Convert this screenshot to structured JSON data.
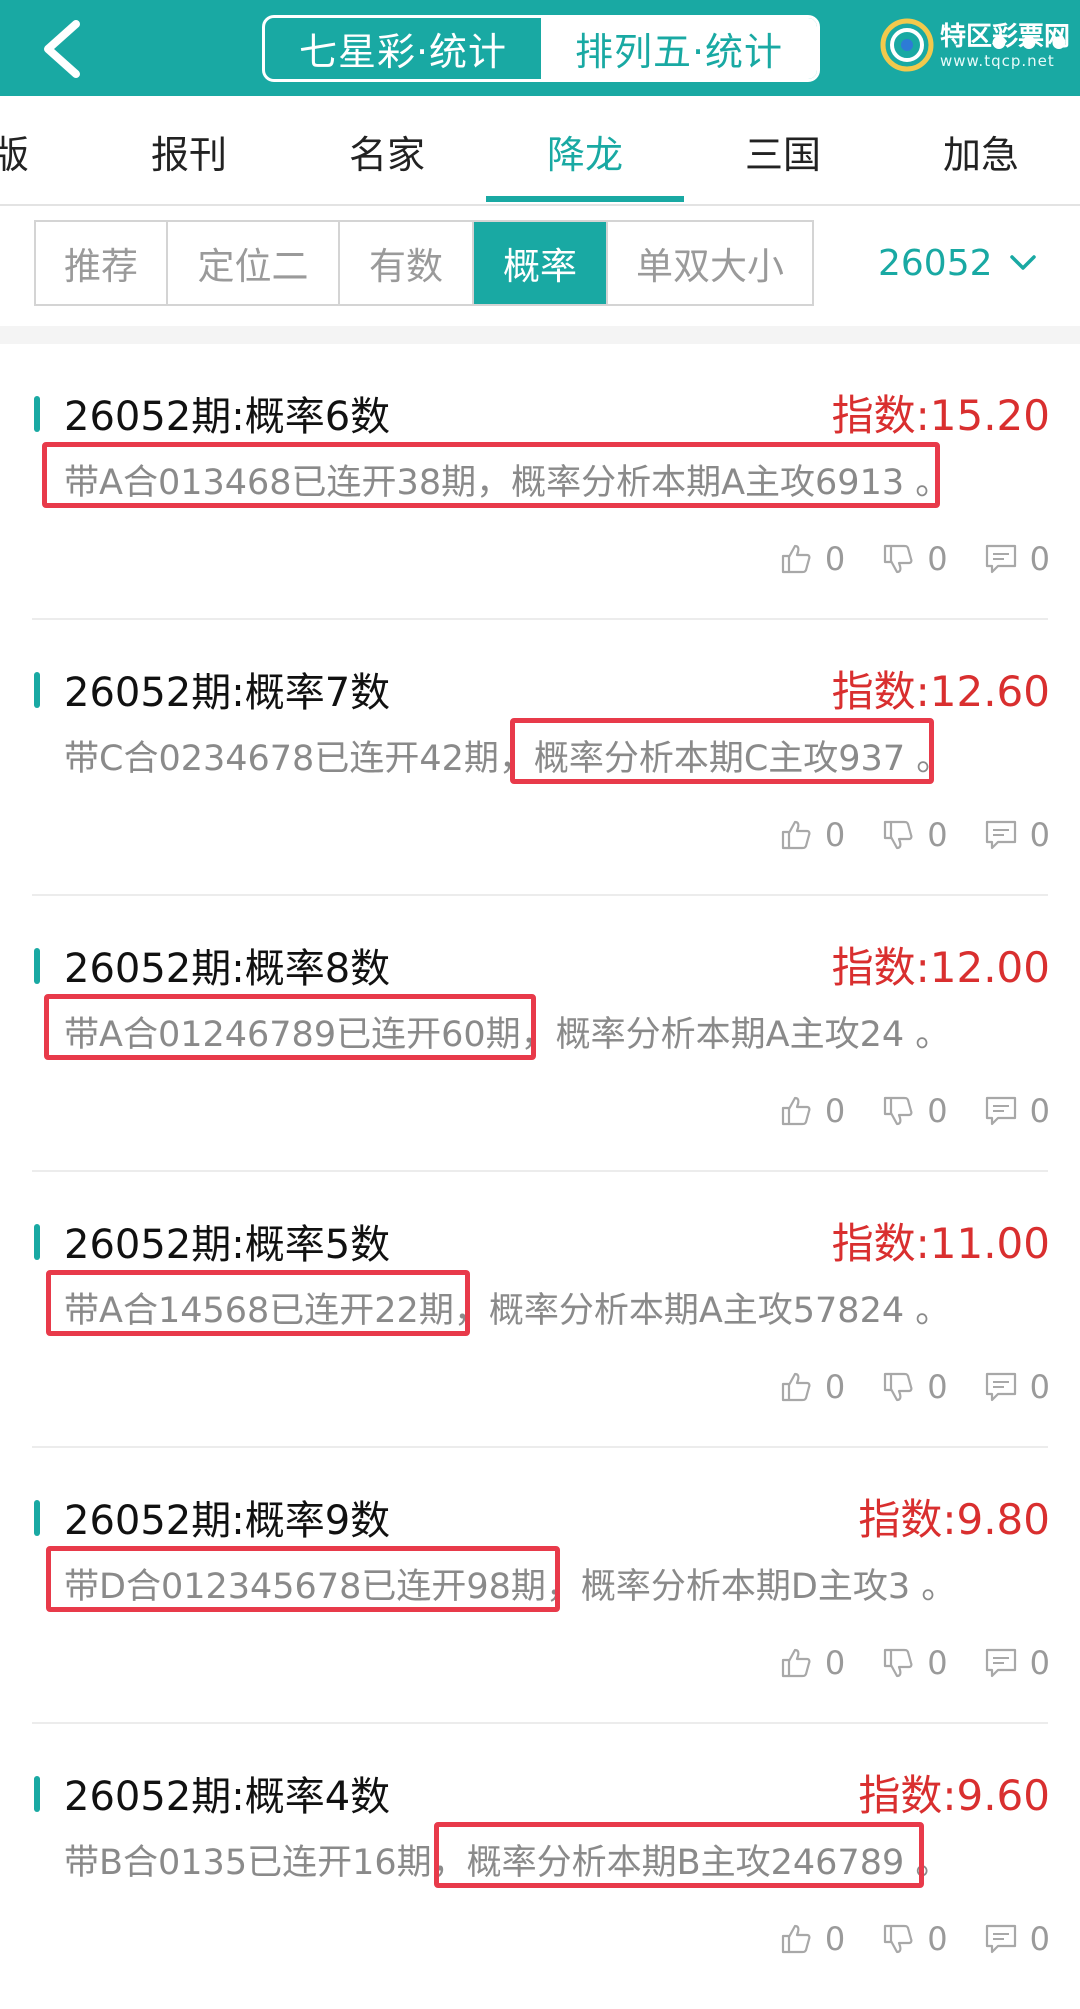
{
  "header": {
    "seg_tabs": [
      "七星彩·统计",
      "排列五·统计"
    ],
    "logo_text": "特区彩票网",
    "logo_sub": "www.tqcp.net"
  },
  "cat_tabs": [
    "版",
    "报刊",
    "名家",
    "降龙",
    "三国",
    "加急"
  ],
  "sub_tabs": [
    "推荐",
    "定位二",
    "有数",
    "概率",
    "单双大小"
  ],
  "issue": "26052",
  "colors": {
    "accent": "#19a9a3",
    "index_red": "#d92f2f",
    "highlight": "#e83a4a"
  },
  "cards": [
    {
      "title": "26052期:概率6数",
      "index": "指数:15.20",
      "desc": "带A合013468已连开38期，概率分析本期A主攻6913 。",
      "likes": "0",
      "dislikes": "0",
      "comments": "0"
    },
    {
      "title": "26052期:概率7数",
      "index": "指数:12.60",
      "desc": "带C合0234678已连开42期，概率分析本期C主攻937 。",
      "likes": "0",
      "dislikes": "0",
      "comments": "0"
    },
    {
      "title": "26052期:概率8数",
      "index": "指数:12.00",
      "desc": "带A合01246789已连开60期，概率分析本期A主攻24 。",
      "likes": "0",
      "dislikes": "0",
      "comments": "0"
    },
    {
      "title": "26052期:概率5数",
      "index": "指数:11.00",
      "desc": "带A合14568已连开22期，概率分析本期A主攻57824 。",
      "likes": "0",
      "dislikes": "0",
      "comments": "0"
    },
    {
      "title": "26052期:概率9数",
      "index": "指数:9.80",
      "desc": "带D合012345678已连开98期，概率分析本期D主攻3 。",
      "likes": "0",
      "dislikes": "0",
      "comments": "0"
    },
    {
      "title": "26052期:概率4数",
      "index": "指数:9.60",
      "desc": "带B合0135已连开16期，概率分析本期B主攻246789 。",
      "likes": "0",
      "dislikes": "0",
      "comments": "0"
    }
  ]
}
